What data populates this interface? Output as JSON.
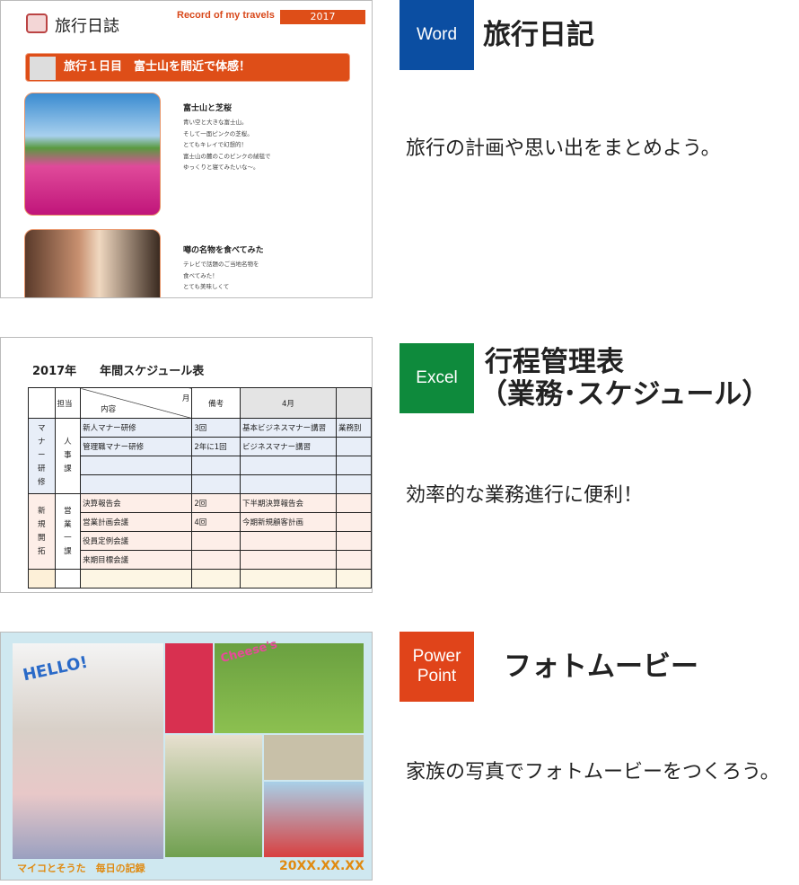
{
  "items": [
    {
      "app": "Word",
      "color": "#0b4ea2",
      "title": "旅行日記",
      "description": "旅行の計画や思い出をまとめよう。"
    },
    {
      "app": "Excel",
      "color": "#0e8a3c",
      "title_line1": "行程管理表",
      "title_line2": "（業務･スケジュール）",
      "description": "効率的な業務進行に便利！"
    },
    {
      "app_line1": "Power",
      "app_line2": "Point",
      "color": "#e0441a",
      "title": "フォトムービー",
      "description": "家族の写真でフォトムービーをつくろう。"
    }
  ],
  "word_preview": {
    "heading": "旅行日誌",
    "record": "Record of my travels",
    "year": "2017",
    "banner": "旅行１日目　富士山を間近で体感！",
    "sections": [
      {
        "title": "富士山と芝桜",
        "lines": [
          "青い空と大きな富士山。",
          "そして一面ピンクの芝桜。",
          "とてもキレイで幻想的！",
          "富士山の麓のこのピンクの絨毯で",
          "ゆっくりと寝てみたいな～。"
        ]
      },
      {
        "title": "噂の名物を食べてみた",
        "lines": [
          "テレビで話題のご当地名物を",
          "食べてみた！",
          "とても美味しくて"
        ]
      }
    ]
  },
  "excel_preview": {
    "title": "2017年　　年間スケジュール表",
    "headers": [
      "担当",
      "月",
      "内容",
      "備考",
      "4月"
    ],
    "group1": {
      "label": "マナー研修",
      "dept": "人事課",
      "rows": [
        [
          "新人マナー研修",
          "3回",
          "基本ビジネスマナー講習",
          "業務別"
        ],
        [
          "管理職マナー研修",
          "2年に1回",
          "ビジネスマナー講習",
          ""
        ],
        [
          "",
          "",
          "",
          ""
        ],
        [
          "",
          "",
          "",
          ""
        ]
      ]
    },
    "group2": {
      "label": "新規開拓",
      "dept": "営業一課",
      "rows": [
        [
          "決算報告会",
          "2回",
          "下半期決算報告会",
          ""
        ],
        [
          "営業計画会議",
          "4回",
          "今期新規顧客計画",
          ""
        ],
        [
          "役員定例会議",
          "",
          "",
          ""
        ],
        [
          "来期目標会議",
          "",
          "",
          ""
        ]
      ]
    }
  },
  "ppt_preview": {
    "hello": "HELLO!",
    "cheese": "Cheese's",
    "caption": "マイコとそうた　毎日の記録",
    "date": "20XX.XX.XX"
  }
}
